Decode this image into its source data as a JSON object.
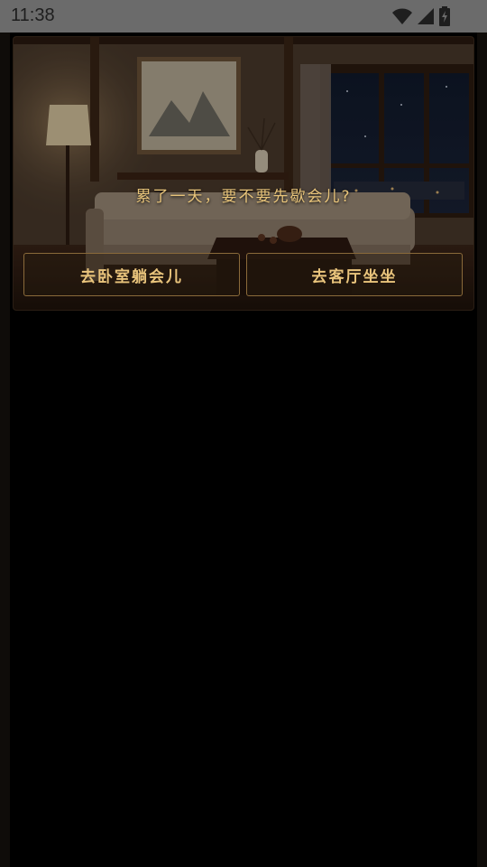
{
  "status_bar": {
    "time": "11:38",
    "icons": [
      "wifi-icon",
      "cell-signal-icon",
      "battery-icon"
    ]
  },
  "scene": {
    "prompt": "累了一天，要不要先歇会儿?",
    "choices": [
      {
        "label": "去卧室躺会儿"
      },
      {
        "label": "去客厅坐坐"
      }
    ]
  },
  "colors": {
    "accent_text": "#e8c47a",
    "button_border": "#8a6a3a",
    "status_bar": "#6b6b6b"
  }
}
